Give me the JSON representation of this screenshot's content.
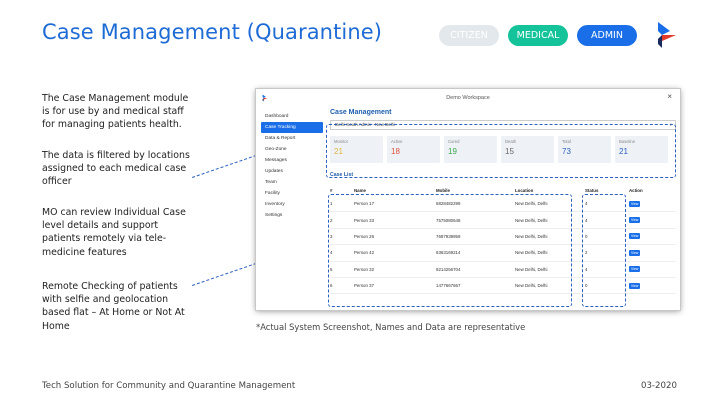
{
  "slide": {
    "title": "Case Management (Quarantine)",
    "roles": [
      "CITIZEN",
      "MEDICAL",
      "ADMIN"
    ],
    "descriptions": [
      "The Case Management module is for use by and medical staff for managing patients health.",
      "The data is filtered by locations assigned to each medical case officer",
      "MO can review Individual Case level details and support patients remotely via tele-medicine features",
      "Remote Checking of patients with selfie and geolocation based flat – At Home or Not At Home"
    ],
    "footnote": "*Actual System Screenshot, Names and Data are representative",
    "footer_left": "Tech Solution for Community and Quarantine Management",
    "footer_right": "03-2020"
  },
  "app": {
    "window_title": "Demo Workspace",
    "close": "×",
    "nav": [
      "Dashboard",
      "Case Tracking",
      "Data & Report",
      "Geo-Zone",
      "Messages",
      "Updates",
      "Team",
      "Facility",
      "Inventory",
      "Settings"
    ],
    "nav_active_index": 1,
    "header": "Case Management",
    "location_select": "Delhi South Admin - New Delhi",
    "select_arrow": "↕",
    "stats": [
      {
        "label": "Monitor",
        "value": "21",
        "color": "#e0b43a"
      },
      {
        "label": "Active",
        "value": "18",
        "color": "#e0503a"
      },
      {
        "label": "Cured",
        "value": "19",
        "color": "#3aa84a"
      },
      {
        "label": "Death",
        "value": "15",
        "color": "#666666"
      },
      {
        "label": "Total",
        "value": "73",
        "color": "#2a5fc0"
      },
      {
        "label": "Baseline",
        "value": "21",
        "color": "#2a5fc0"
      }
    ],
    "case_list_title": "Case List",
    "columns": [
      "#",
      "Name",
      "Mobile",
      "Location",
      "Status",
      "Action"
    ],
    "rows": [
      [
        "1",
        "Person 17",
        "6828482299",
        "New Delhi, Delhi",
        "4",
        "View"
      ],
      [
        "2",
        "Person 33",
        "7575080648",
        "New Delhi, Delhi",
        "4",
        "View"
      ],
      [
        "3",
        "Person 26",
        "7697939959",
        "New Delhi, Delhi",
        "0",
        "View"
      ],
      [
        "4",
        "Person 42",
        "6363169214",
        "New Delhi, Delhi",
        "2",
        "View"
      ],
      [
        "5",
        "Person 32",
        "9214256704",
        "New Delhi, Delhi",
        "4",
        "View"
      ],
      [
        "6",
        "Person 37",
        "1477667667",
        "New Delhi, Delhi",
        "0",
        "View"
      ]
    ]
  },
  "colors": {
    "accent": "#1f6bd6",
    "medical": "#15c39a",
    "admin": "#1a6fe8",
    "citizen": "#e3e8ec"
  }
}
